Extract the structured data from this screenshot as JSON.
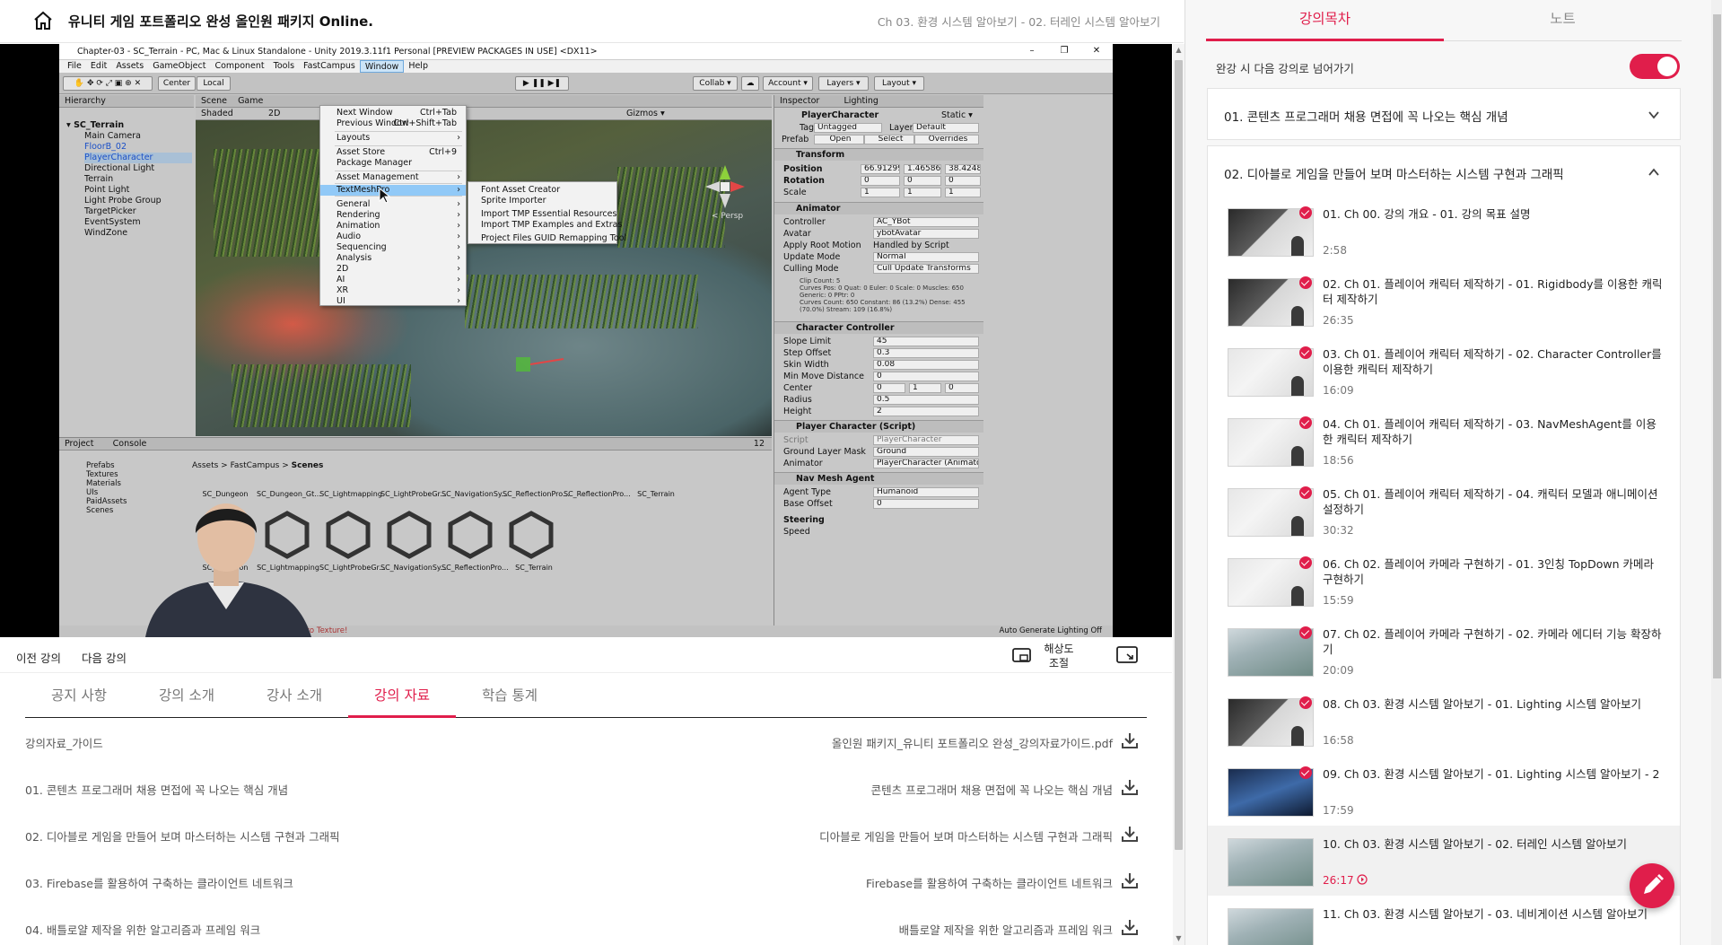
{
  "header": {
    "course_title": "유니티 게임 포트폴리오 완성 올인원 패키지 Online.",
    "current_lecture": "Ch 03. 환경 시스템 알아보기 - 02. 터레인 시스템 알아보기"
  },
  "unity": {
    "window_title": "Chapter-03 - SC_Terrain - PC, Mac & Linux Standalone - Unity 2019.3.11f1 Personal [PREVIEW PACKAGES IN USE] <DX11>",
    "menubar": [
      "File",
      "Edit",
      "Assets",
      "GameObject",
      "Component",
      "Tools",
      "FastCampus",
      "Window",
      "Help"
    ],
    "active_menu": "Window",
    "toolbar": {
      "center": "Center",
      "local": "Local",
      "collab": "Collab ▾",
      "account": "Account ▾",
      "layers": "Layers ▾",
      "layout": "Layout ▾"
    },
    "hierarchy": {
      "tab": "Hierarchy",
      "scene": "SC_Terrain",
      "items": [
        "Main Camera",
        "FloorB_02",
        "PlayerCharacter",
        "Directional Light",
        "Terrain",
        "Point Light",
        "Light Probe Group",
        "TargetPicker",
        "EventSystem",
        "WindZone"
      ]
    },
    "scene_tabs": [
      "Scene",
      "Game"
    ],
    "scene_shading": "Shaded",
    "scene_2d": "2D",
    "gizmos": "Gizmos ▾",
    "persp": "< Persp",
    "window_menu": [
      {
        "label": "Next Window",
        "shortcut": "Ctrl+Tab"
      },
      {
        "label": "Previous Window",
        "shortcut": "Ctrl+Shift+Tab"
      },
      {
        "label": "Layouts",
        "shortcut": ""
      },
      {
        "label": "Asset Store",
        "shortcut": "Ctrl+9"
      },
      {
        "label": "Package Manager",
        "shortcut": ""
      },
      {
        "label": "Asset Management",
        "shortcut": ""
      },
      {
        "label": "TextMeshPro",
        "shortcut": ""
      },
      {
        "label": "General",
        "shortcut": ""
      },
      {
        "label": "Rendering",
        "shortcut": ""
      },
      {
        "label": "Animation",
        "shortcut": ""
      },
      {
        "label": "Audio",
        "shortcut": ""
      },
      {
        "label": "Sequencing",
        "shortcut": ""
      },
      {
        "label": "Analysis",
        "shortcut": ""
      },
      {
        "label": "2D",
        "shortcut": ""
      },
      {
        "label": "AI",
        "shortcut": ""
      },
      {
        "label": "XR",
        "shortcut": ""
      },
      {
        "label": "UI",
        "shortcut": ""
      }
    ],
    "tmp_menu": [
      "Font Asset Creator",
      "Sprite Importer",
      "Import TMP Essential Resources",
      "Import TMP Examples and Extras",
      "Project Files GUID Remapping Tool"
    ],
    "inspector": {
      "tabs": [
        "Inspector",
        "Lighting"
      ],
      "object": "PlayerCharacter",
      "static": "Static ▾",
      "tag": "Untagged",
      "layer": "Default",
      "prefab_buttons": [
        "Prefab",
        "Open",
        "Select",
        "Overrides"
      ],
      "transform": {
        "title": "Transform",
        "position": [
          "66.91299",
          "1.465866",
          "38.4248"
        ],
        "rotation": [
          "0",
          "0",
          "0"
        ],
        "scale": [
          "1",
          "1",
          "1"
        ]
      },
      "animator": {
        "title": "Animator",
        "controller": "AC_YBot",
        "avatar": "ybotAvatar",
        "root_motion": "Handled by Script",
        "update_mode": "Normal",
        "culling_mode": "Cull Update Transforms",
        "info": "Clip Count: 5\nCurves Pos: 0 Quat: 0 Euler: 0 Scale: 0 Muscles: 650 Generic: 0 PPtr: 0\nCurves Count: 650 Constant: 86 (13.2%) Dense: 455 (70.0%) Stream: 109 (16.8%)"
      },
      "character_controller": {
        "title": "Character Controller",
        "slope_limit": "45",
        "step_offset": "0.3",
        "skin_width": "0.08",
        "min_move": "0",
        "center": [
          "0",
          "1",
          "0"
        ],
        "radius": "0.5",
        "height": "2"
      },
      "player_script": {
        "title": "Player Character (Script)",
        "script": "PlayerCharacter",
        "ground_mask": "Ground",
        "animator": "PlayerCharacter (Animator)"
      },
      "nav_agent": {
        "title": "Nav Mesh Agent",
        "agent_type": "Humanoid",
        "base_offset": "0",
        "steering": "Steering",
        "speed": "Speed"
      }
    },
    "project": {
      "tabs": [
        "Project",
        "Console"
      ],
      "folders": [
        "Prefabs",
        "Textures",
        "Materials",
        "UIs",
        "PaidAssets",
        "Scenes",
        "SC_Dun...",
        "SC_Dun...",
        "SC_Lightm...",
        "SC_Li..."
      ],
      "breadcrumb": [
        "Assets",
        "FastCampus",
        "Scenes"
      ],
      "row1": [
        "SC_Dungeon",
        "SC_Dungeon_Gt...",
        "SC_Lightmapping",
        "SC_LightProbeGr...",
        "SC_NavigationSy...",
        "SC_ReflectionPro...",
        "SC_ReflectionPro...",
        "SC_Terrain"
      ],
      "row2": [
        "SC_Dungeon",
        "SC_Lightmapping",
        "SC_LightProbeGr...",
        "SC_NavigationSy...",
        "SC_ReflectionPro...",
        "SC_Terrain"
      ],
      "count": "12"
    },
    "status_left": "om ScriptMapper to Texture!",
    "status_right": "Auto Generate Lighting Off"
  },
  "player_bar": {
    "prev": "이전 강의",
    "next": "다음 강의",
    "resolution": "해상도\n조절"
  },
  "tabs": [
    {
      "label": "공지 사항",
      "active": false
    },
    {
      "label": "강의 소개",
      "active": false
    },
    {
      "label": "강사 소개",
      "active": false
    },
    {
      "label": "강의 자료",
      "active": true
    },
    {
      "label": "학습 통계",
      "active": false
    }
  ],
  "materials": [
    {
      "title": "강의자료_가이드",
      "file": "올인원 패키지_유니티 포트폴리오 완성_강의자료가이드.pdf"
    },
    {
      "title": "01. 콘텐츠 프로그래머 채용 면접에 꼭 나오는 핵심 개념",
      "file": "콘텐츠 프로그래머 채용 면접에 꼭 나오는 핵심 개념"
    },
    {
      "title": "02. 디아블로 게임을 만들어 보며 마스터하는 시스템 구현과 그래픽",
      "file": "디아블로 게임을 만들어 보며 마스터하는 시스템 구현과 그래픽"
    },
    {
      "title": "03. Firebase를 활용하여 구축하는 클라이언트 네트워크",
      "file": "Firebase를 활용하여 구축하는 클라이언트 네트워크"
    },
    {
      "title": "04. 배틀로얄 제작을 위한 알고리즘과 프레임 워크",
      "file": "배틀로얄 제작을 위한 알고리즘과 프레임 워크"
    }
  ],
  "right_panel": {
    "tabs": [
      {
        "label": "강의목차",
        "active": true
      },
      {
        "label": "노트",
        "active": false
      }
    ],
    "autoplay_label": "완강 시 다음 강의로 넘어가기",
    "autoplay_on": true,
    "chapters": [
      {
        "title": "01. 콘텐츠 프로그래머 채용 면접에 꼭 나오는 핵심 개념",
        "expanded": false
      },
      {
        "title": "02. 디아블로 게임을 만들어 보며 마스터하는 시스템 구현과 그래픽",
        "expanded": true
      }
    ],
    "lectures": [
      {
        "title": "01. Ch 00. 강의 개요 - 01. 강의 목표 설명",
        "duration": "2:58",
        "done": true,
        "thumb": "dark"
      },
      {
        "title": "02. Ch 01. 플레이어 캐릭터 제작하기 - 01. Rigidbody를 이용한 캐릭터 제작하기",
        "duration": "26:35",
        "done": true,
        "thumb": "dark"
      },
      {
        "title": "03. Ch 01. 플레이어 캐릭터 제작하기 - 02. Character Controller를 이용한 캐릭터 제작하기",
        "duration": "16:09",
        "done": true,
        "thumb": "light"
      },
      {
        "title": "04. Ch 01. 플레이어 캐릭터 제작하기 - 03. NavMeshAgent를 이용한 캐릭터 제작하기",
        "duration": "18:56",
        "done": true,
        "thumb": "light"
      },
      {
        "title": "05. Ch 01. 플레이어 캐릭터 제작하기 - 04. 캐릭터 모델과 애니메이션 설정하기",
        "duration": "30:32",
        "done": true,
        "thumb": "light"
      },
      {
        "title": "06. Ch 02. 플레이어 카메라 구현하기 - 01. 3인칭 TopDown 카메라 구현하기",
        "duration": "15:59",
        "done": true,
        "thumb": "light"
      },
      {
        "title": "07. Ch 02. 플레이어 카메라 구현하기 - 02. 카메라 에디터 기능 확장하기",
        "duration": "20:09",
        "done": true,
        "thumb": "game"
      },
      {
        "title": "08. Ch 03. 환경 시스템 알아보기 - 01. Lighting 시스템 알아보기",
        "duration": "16:58",
        "done": true,
        "thumb": "dark"
      },
      {
        "title": "09. Ch 03. 환경 시스템 알아보기 - 01. Lighting 시스템 알아보기 - 2",
        "duration": "17:59",
        "done": true,
        "thumb": "blue"
      },
      {
        "title": "10. Ch 03. 환경 시스템 알아보기 - 02. 터레인 시스템 알아보기",
        "duration": "26:17",
        "done": false,
        "current": true,
        "thumb": "game"
      },
      {
        "title": "11. Ch 03. 환경 시스템 알아보기 - 03. 네비게이션 시스템 알아보기",
        "duration": "",
        "done": false,
        "thumb": "game"
      }
    ]
  },
  "colors": {
    "accent": "#e01e4b"
  }
}
